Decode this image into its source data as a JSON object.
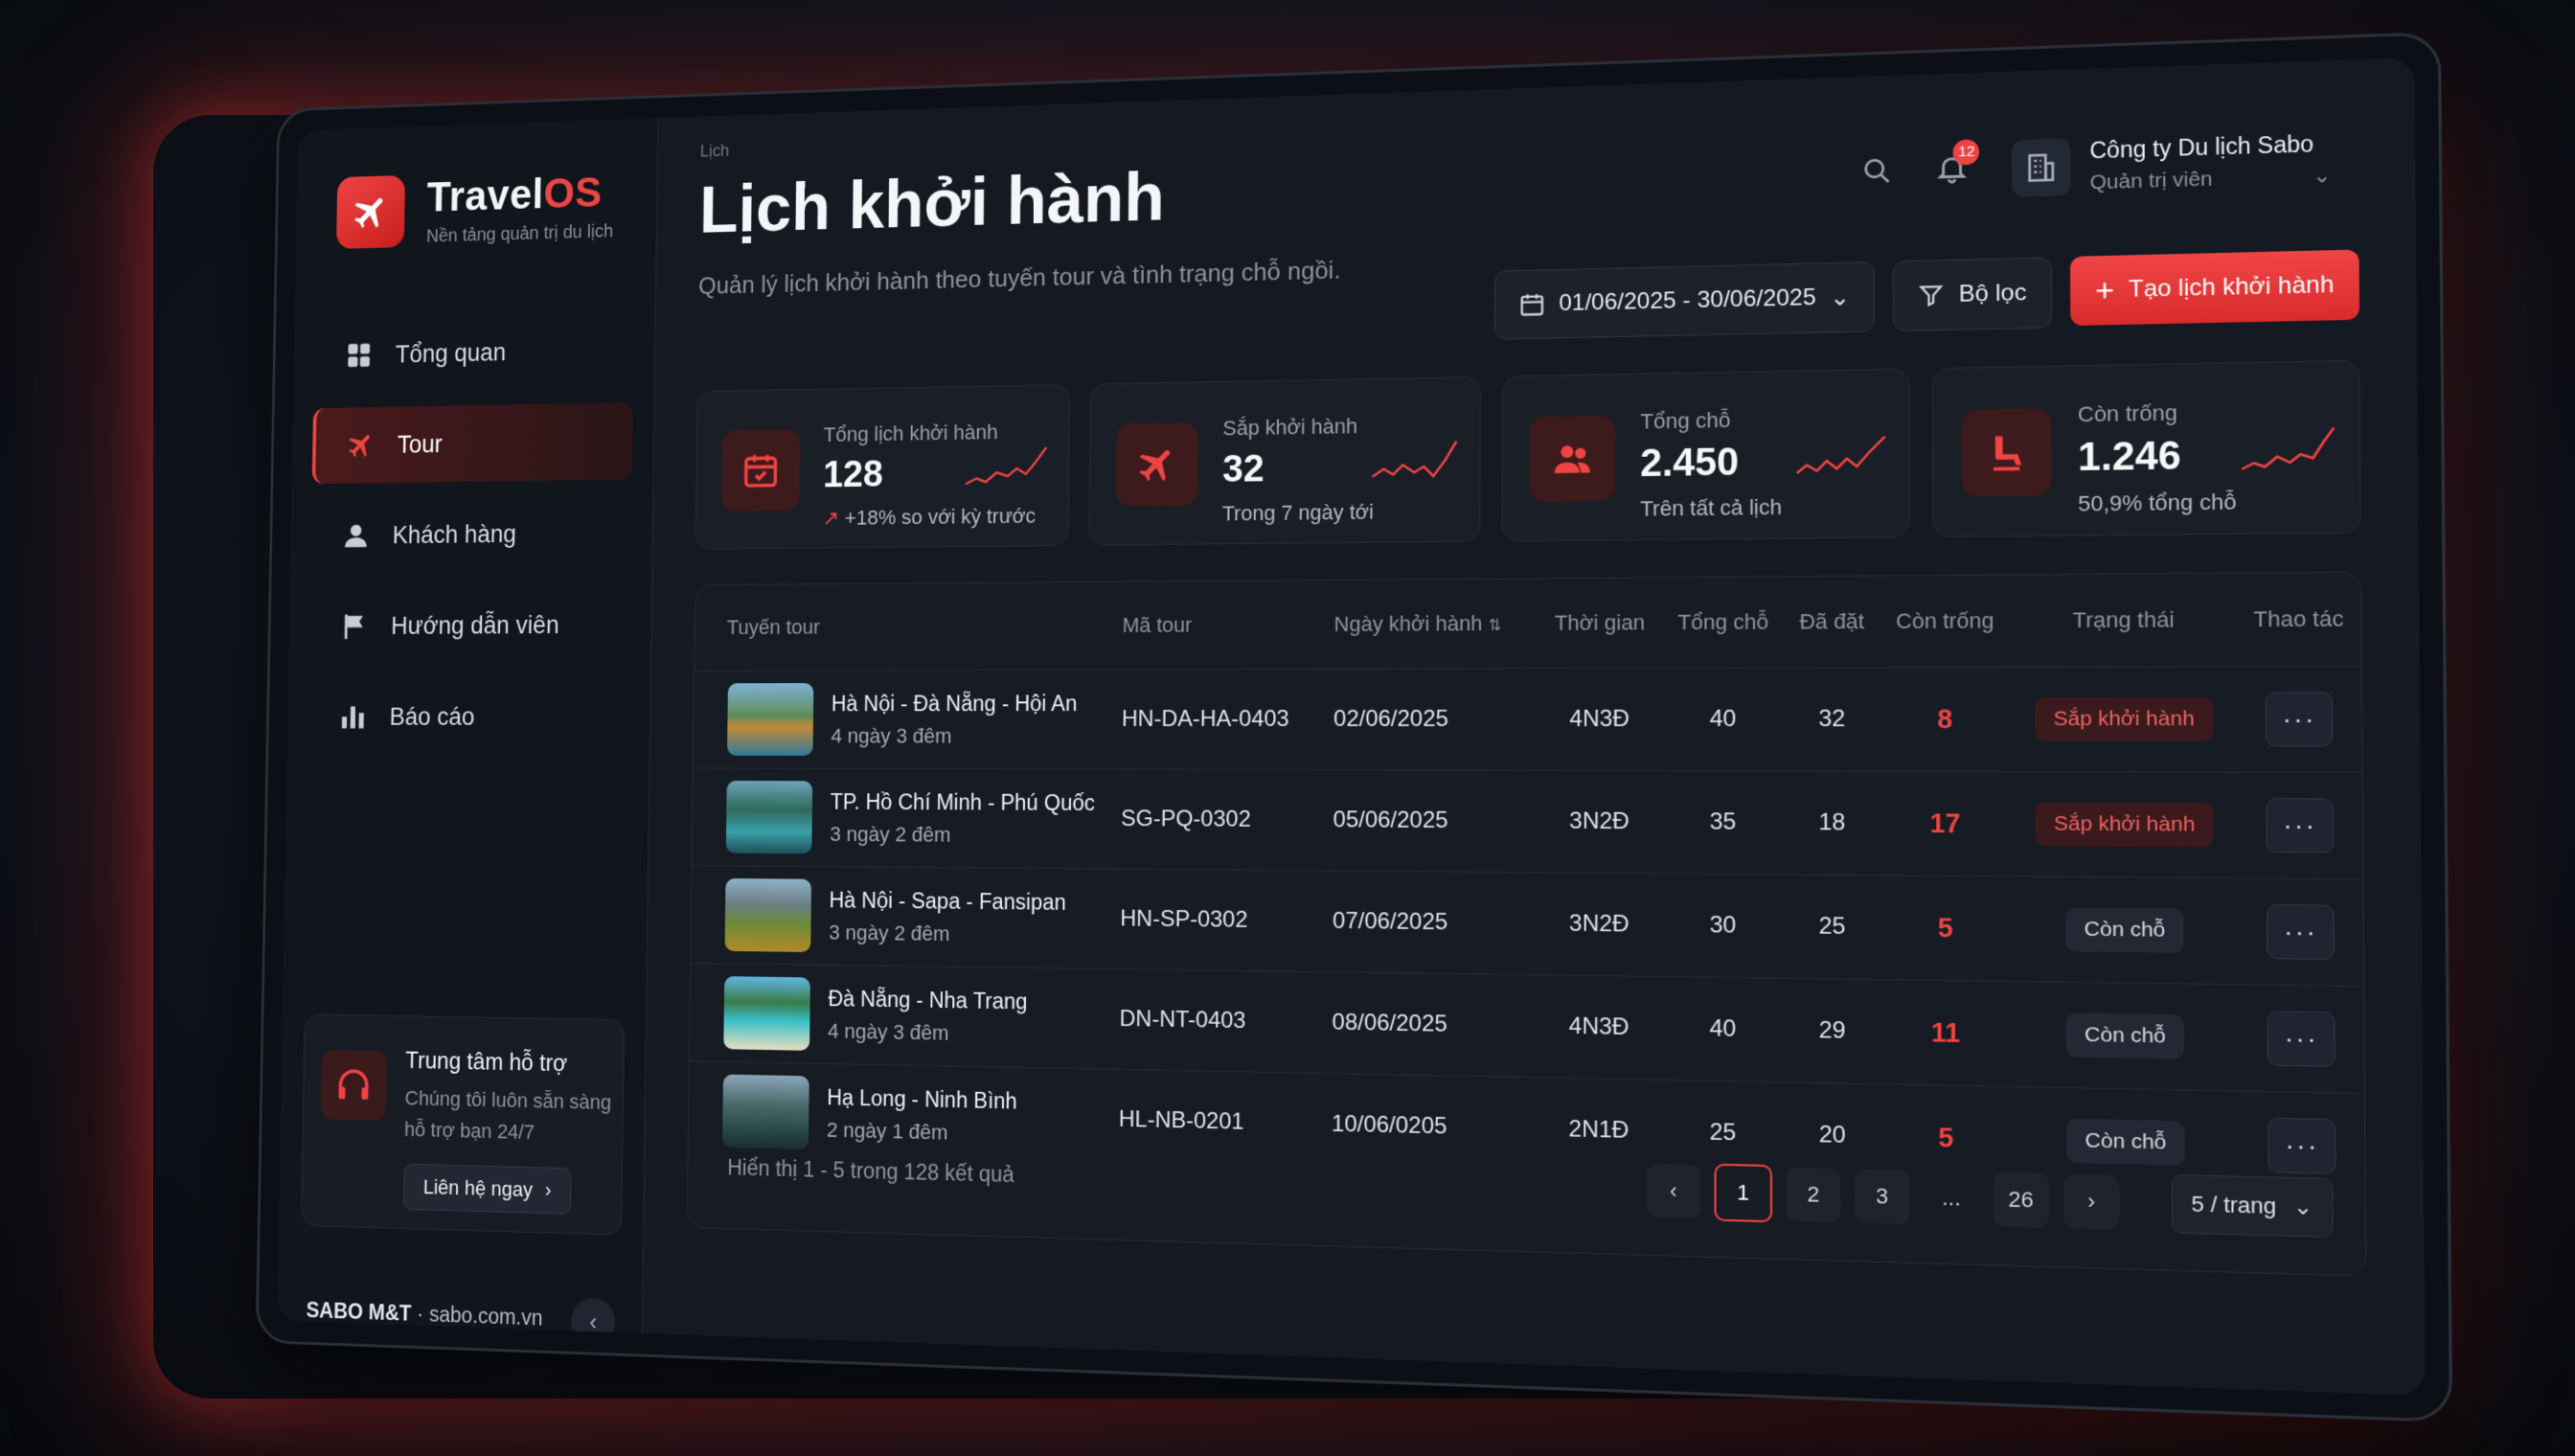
{
  "app": {
    "brand_main": "Travel",
    "brand_accent": "OS",
    "tagline": "Nền tảng quản trị du lịch"
  },
  "sidebar": {
    "items": [
      {
        "label": "Tổng quan",
        "icon": "grid-icon",
        "active": false
      },
      {
        "label": "Tour",
        "icon": "plane-icon",
        "active": true
      },
      {
        "label": "Khách hàng",
        "icon": "user-icon",
        "active": false
      },
      {
        "label": "Hướng dẫn viên",
        "icon": "flag-icon",
        "active": false
      },
      {
        "label": "Báo cáo",
        "icon": "bar-chart-icon",
        "active": false
      }
    ],
    "support": {
      "title": "Trung tâm hỗ trợ",
      "desc": "Chúng tôi luôn sẵn sàng hỗ trợ bạn 24/7",
      "button": "Liên hệ ngay"
    },
    "footer": {
      "brand": "SABO M&T",
      "site": "sabo.com.vn"
    }
  },
  "header": {
    "breadcrumb": "Lịch",
    "title": "Lịch khởi hành",
    "subtitle": "Quản lý lịch khởi hành theo tuyến tour và tình trạng chỗ ngồi.",
    "notifications": "12",
    "company": {
      "name": "Công ty Du lịch Sabo",
      "role": "Quản trị viên"
    },
    "date_range": "01/06/2025 - 30/06/2025",
    "filter_label": "Bộ lọc",
    "create_label": "Tạo lịch khởi hành"
  },
  "stats": [
    {
      "label": "Tổng lịch khởi hành",
      "value": "128",
      "sub": "+18% so với kỳ trước",
      "icon": "calendar-icon"
    },
    {
      "label": "Sắp khởi hành",
      "value": "32",
      "sub": "Trong 7 ngày tới",
      "icon": "plane-icon"
    },
    {
      "label": "Tổng chỗ",
      "value": "2.450",
      "sub": "Trên tất cả lịch",
      "icon": "users-icon"
    },
    {
      "label": "Còn trống",
      "value": "1.246",
      "sub": "50,9% tổng chỗ",
      "icon": "seat-icon"
    }
  ],
  "table": {
    "headers": [
      "Tuyến tour",
      "Mã tour",
      "Ngày khởi hành",
      "Thời gian",
      "Tổng chỗ",
      "Đã đặt",
      "Còn trống",
      "Trạng thái",
      "Thao tác"
    ],
    "rows": [
      {
        "name": "Hà Nội - Đà Nẵng - Hội An",
        "duration": "4 ngày 3 đêm",
        "code": "HN-DA-HA-0403",
        "date": "02/06/2025",
        "time": "4N3Đ",
        "total": "40",
        "booked": "32",
        "available": "8",
        "status": "Sắp khởi hành"
      },
      {
        "name": "TP. Hồ Chí Minh - Phú Quốc",
        "duration": "3 ngày 2 đêm",
        "code": "SG-PQ-0302",
        "date": "05/06/2025",
        "time": "3N2Đ",
        "total": "35",
        "booked": "18",
        "available": "17",
        "status": "Sắp khởi hành"
      },
      {
        "name": "Hà Nội - Sapa - Fansipan",
        "duration": "3 ngày 2 đêm",
        "code": "HN-SP-0302",
        "date": "07/06/2025",
        "time": "3N2Đ",
        "total": "30",
        "booked": "25",
        "available": "5",
        "status": "Còn chỗ"
      },
      {
        "name": "Đà Nẵng - Nha Trang",
        "duration": "4 ngày 3 đêm",
        "code": "DN-NT-0403",
        "date": "08/06/2025",
        "time": "4N3Đ",
        "total": "40",
        "booked": "29",
        "available": "11",
        "status": "Còn chỗ"
      },
      {
        "name": "Hạ Long - Ninh Bình",
        "duration": "2 ngày 1 đêm",
        "code": "HL-NB-0201",
        "date": "10/06/0205",
        "time": "2N1Đ",
        "total": "25",
        "booked": "20",
        "available": "5",
        "status": "Còn chỗ"
      }
    ],
    "showing": "Hiển thị 1 - 5 trong 128 kết quả",
    "pages": [
      "1",
      "2",
      "3",
      "...",
      "26"
    ],
    "per_page": "5 / trang"
  },
  "colors": {
    "accent": "#ef4444",
    "background": "#151922"
  }
}
